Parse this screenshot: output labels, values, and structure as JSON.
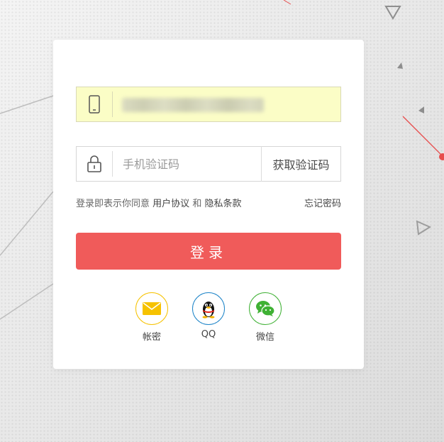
{
  "login": {
    "phone_value": "",
    "code_placeholder": "手机验证码",
    "get_code_label": "获取验证码",
    "agreement": {
      "prefix": "登录即表示你同意",
      "user_agreement": "用户协议",
      "and": "和",
      "privacy": "隐私条款"
    },
    "forgot_password": "忘记密码",
    "submit_label": "登录"
  },
  "social": {
    "items": [
      {
        "label": "帐密",
        "icon": "envelope-icon",
        "color": "#f6c200"
      },
      {
        "label": "QQ",
        "icon": "qq-penguin-icon",
        "color": "#1d84c8"
      },
      {
        "label": "微信",
        "icon": "wechat-icon",
        "color": "#3fb134"
      }
    ]
  },
  "colors": {
    "accent": "#f05b5a",
    "autofill": "#fbfdc6"
  }
}
